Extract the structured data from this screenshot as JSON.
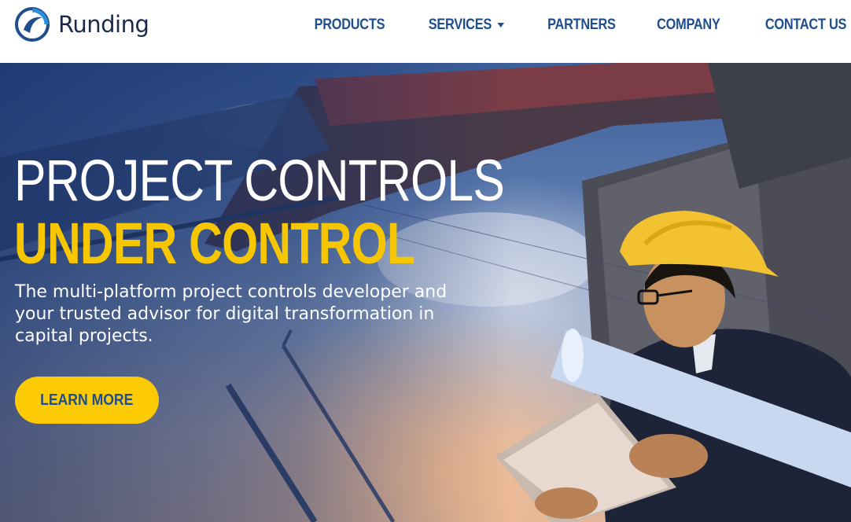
{
  "brand": {
    "name": "Runding",
    "logo_icon": "swirl-logo-icon",
    "colors": {
      "navy": "#1b2a4a",
      "blue": "#1f4e8c",
      "yellow": "#f6c700",
      "button": "#fdcb06"
    }
  },
  "nav": {
    "items": [
      {
        "label": "PRODUCTS",
        "has_dropdown": false
      },
      {
        "label": "SERVICES",
        "has_dropdown": true,
        "icon": "caret-down-icon"
      },
      {
        "label": "PARTNERS",
        "has_dropdown": false
      },
      {
        "label": "COMPANY",
        "has_dropdown": false
      },
      {
        "label": "CONTACT US",
        "has_dropdown": false
      }
    ]
  },
  "hero": {
    "headline": "PROJECT CONTROLS",
    "headline_accent": "UNDER CONTROL",
    "subtext": "The multi-platform project controls developer and your trusted advisor for digital transformation in capital projects.",
    "cta_label": "LEARN MORE"
  }
}
